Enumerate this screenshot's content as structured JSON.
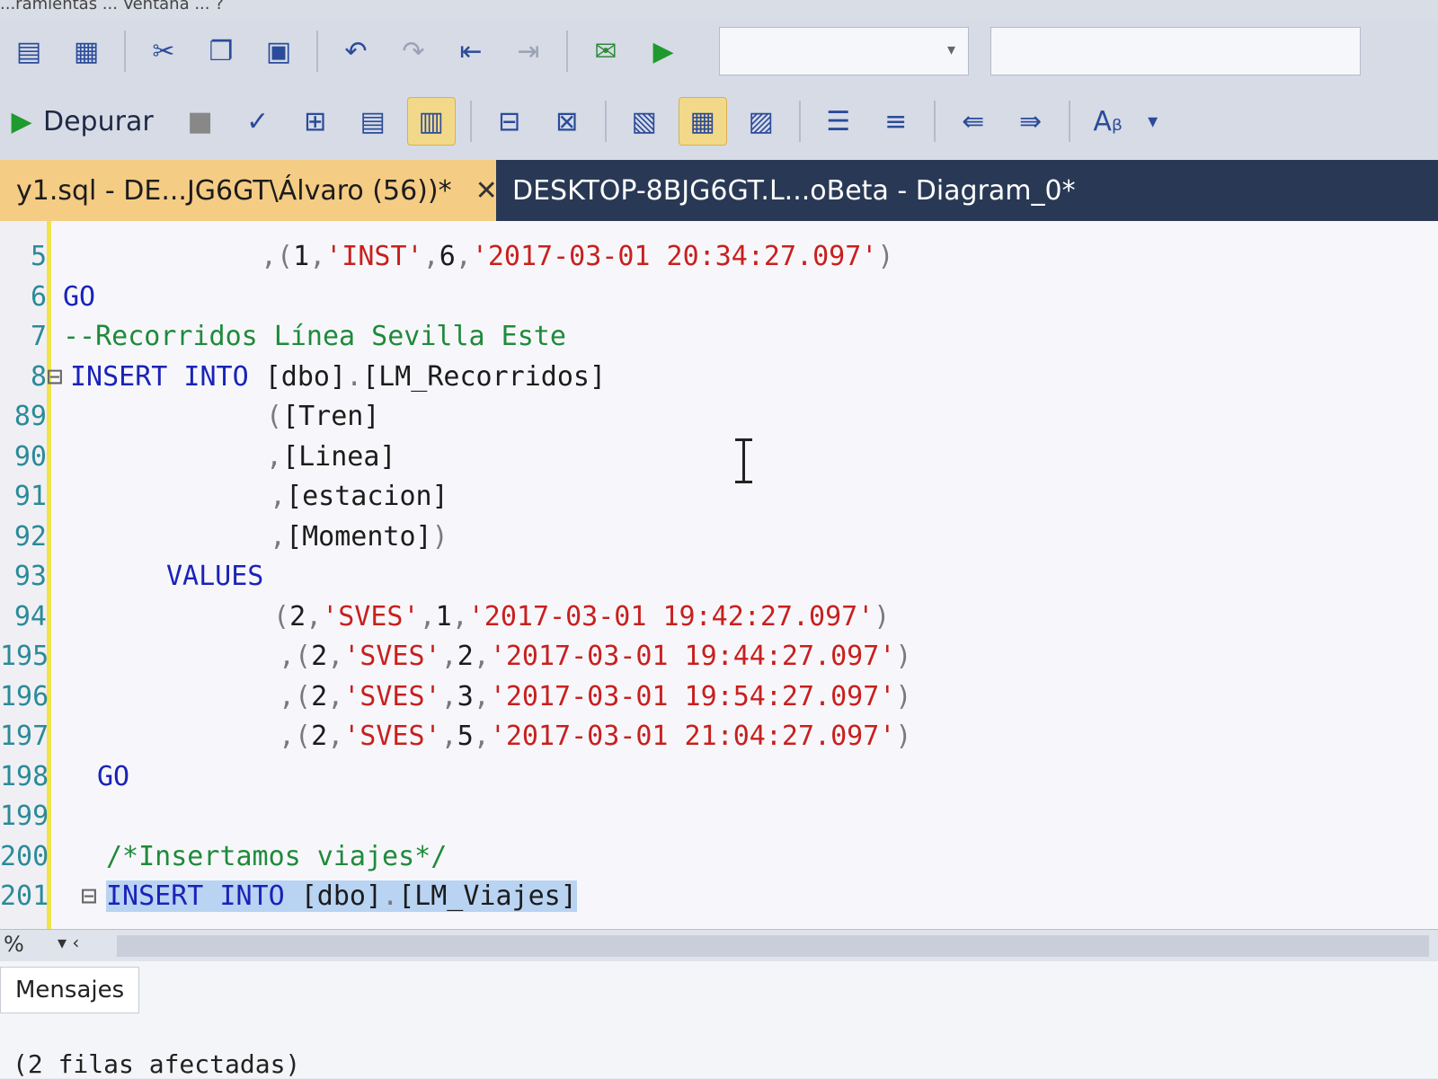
{
  "menubar": {
    "text": "...ramientas ... Ventana ... ?"
  },
  "toolbar2": {
    "debug_label": "Depurar"
  },
  "tabs": [
    {
      "label": "y1.sql - DE...JG6GT\\Álvaro (56))*",
      "close": "✕"
    },
    {
      "label": "DESKTOP-8BJG6GT.L...oBeta - Diagram_0*"
    }
  ],
  "editor": {
    "lines": [
      {
        "n": "5",
        "parts": [
          {
            "c": "op",
            "t": ",("
          },
          {
            "c": "tx",
            "t": "1"
          },
          {
            "c": "op",
            "t": ","
          },
          {
            "c": "str",
            "t": "'INST'"
          },
          {
            "c": "op",
            "t": ","
          },
          {
            "c": "tx",
            "t": "6"
          },
          {
            "c": "op",
            "t": ","
          },
          {
            "c": "str",
            "t": "'2017-03-01 20:34:27.097'"
          },
          {
            "c": "op",
            "t": ")"
          }
        ]
      },
      {
        "n": "6",
        "parts": [
          {
            "c": "kw",
            "t": "GO"
          }
        ]
      },
      {
        "n": "7",
        "parts": [
          {
            "c": "cm",
            "t": "--Recorridos Línea Sevilla Este"
          }
        ]
      },
      {
        "n": "8",
        "parts": [
          {
            "c": "kw",
            "t": "INSERT INTO "
          },
          {
            "c": "tx",
            "t": "[dbo]"
          },
          {
            "c": "op",
            "t": "."
          },
          {
            "c": "tx",
            "t": "[LM_Recorridos]"
          }
        ]
      },
      {
        "n": "89",
        "parts": [
          {
            "c": "op",
            "t": "("
          },
          {
            "c": "tx",
            "t": "[Tren]"
          }
        ]
      },
      {
        "n": "90",
        "parts": [
          {
            "c": "op",
            "t": ","
          },
          {
            "c": "tx",
            "t": "[Linea]"
          }
        ]
      },
      {
        "n": "91",
        "parts": [
          {
            "c": "op",
            "t": ","
          },
          {
            "c": "tx",
            "t": "[estacion]"
          }
        ]
      },
      {
        "n": "92",
        "parts": [
          {
            "c": "op",
            "t": ","
          },
          {
            "c": "tx",
            "t": "[Momento]"
          },
          {
            "c": "op",
            "t": ")"
          }
        ]
      },
      {
        "n": "93",
        "parts": [
          {
            "c": "kw",
            "t": "VALUES"
          }
        ]
      },
      {
        "n": "94",
        "parts": [
          {
            "c": "op",
            "t": "("
          },
          {
            "c": "tx",
            "t": "2"
          },
          {
            "c": "op",
            "t": ","
          },
          {
            "c": "str",
            "t": "'SVES'"
          },
          {
            "c": "op",
            "t": ","
          },
          {
            "c": "tx",
            "t": "1"
          },
          {
            "c": "op",
            "t": ","
          },
          {
            "c": "str",
            "t": "'2017-03-01 19:42:27.097'"
          },
          {
            "c": "op",
            "t": ")"
          }
        ]
      },
      {
        "n": "195",
        "parts": [
          {
            "c": "op",
            "t": ",("
          },
          {
            "c": "tx",
            "t": "2"
          },
          {
            "c": "op",
            "t": ","
          },
          {
            "c": "str",
            "t": "'SVES'"
          },
          {
            "c": "op",
            "t": ","
          },
          {
            "c": "tx",
            "t": "2"
          },
          {
            "c": "op",
            "t": ","
          },
          {
            "c": "str",
            "t": "'2017-03-01 19:44:27.097'"
          },
          {
            "c": "op",
            "t": ")"
          }
        ]
      },
      {
        "n": "196",
        "parts": [
          {
            "c": "op",
            "t": ",("
          },
          {
            "c": "tx",
            "t": "2"
          },
          {
            "c": "op",
            "t": ","
          },
          {
            "c": "str",
            "t": "'SVES'"
          },
          {
            "c": "op",
            "t": ","
          },
          {
            "c": "tx",
            "t": "3"
          },
          {
            "c": "op",
            "t": ","
          },
          {
            "c": "str",
            "t": "'2017-03-01 19:54:27.097'"
          },
          {
            "c": "op",
            "t": ")"
          }
        ]
      },
      {
        "n": "197",
        "parts": [
          {
            "c": "op",
            "t": ",("
          },
          {
            "c": "tx",
            "t": "2"
          },
          {
            "c": "op",
            "t": ","
          },
          {
            "c": "str",
            "t": "'SVES'"
          },
          {
            "c": "op",
            "t": ","
          },
          {
            "c": "tx",
            "t": "5"
          },
          {
            "c": "op",
            "t": ","
          },
          {
            "c": "str",
            "t": "'2017-03-01 21:04:27.097'"
          },
          {
            "c": "op",
            "t": ")"
          }
        ]
      },
      {
        "n": "198",
        "parts": [
          {
            "c": "kw",
            "t": "GO"
          }
        ]
      },
      {
        "n": "199",
        "parts": []
      },
      {
        "n": "200",
        "parts": [
          {
            "c": "cm",
            "t": "/*Insertamos viajes*/"
          }
        ]
      },
      {
        "n": "201",
        "parts": [
          {
            "c": "kw sel",
            "t": "INSERT INTO "
          },
          {
            "c": "tx sel",
            "t": "[dbo]"
          },
          {
            "c": "op sel",
            "t": "."
          },
          {
            "c": "tx sel",
            "t": "[LM_Viajes]"
          }
        ]
      }
    ]
  },
  "status": {
    "zoom": "%"
  },
  "results": {
    "tab_label": "Mensajes",
    "message": "(2 filas afectadas)"
  }
}
